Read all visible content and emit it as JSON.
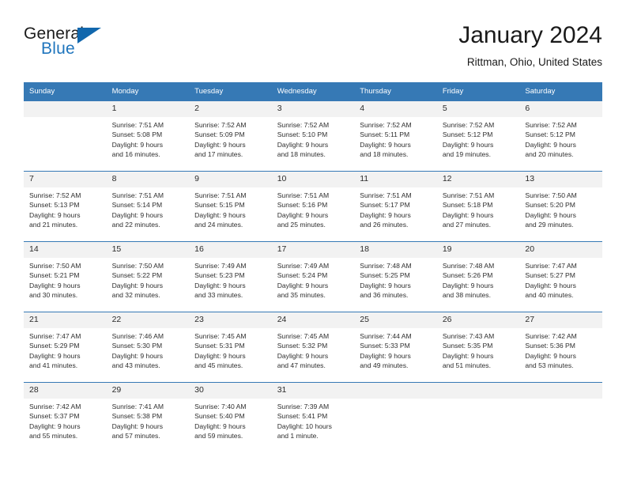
{
  "brand": {
    "name_part1": "General",
    "name_part2": "Blue",
    "triangle_icon": "triangle-icon",
    "colors": {
      "general": "#1c1c1c",
      "blue": "#1f75bd",
      "triangle": "#1167ad"
    }
  },
  "header": {
    "title": "January 2024",
    "subtitle": "Rittman, Ohio, United States"
  },
  "colors": {
    "header_row_background": "#3679b5",
    "header_row_text": "#ffffff",
    "daynum_background": "#f2f2f2",
    "cell_border": "#3679b5",
    "page_background": "#ffffff"
  },
  "weekday_headers": [
    "Sunday",
    "Monday",
    "Tuesday",
    "Wednesday",
    "Thursday",
    "Friday",
    "Saturday"
  ],
  "labels": {
    "sunrise_prefix": "Sunrise:",
    "sunset_prefix": "Sunset:",
    "daylight_prefix": "Daylight:"
  },
  "weeks": [
    [
      {
        "day": "",
        "sunrise": "",
        "sunset": "",
        "daylight_line1": "",
        "daylight_line2": "",
        "empty": true
      },
      {
        "day": "1",
        "sunrise": "Sunrise: 7:51 AM",
        "sunset": "Sunset: 5:08 PM",
        "daylight_line1": "Daylight: 9 hours",
        "daylight_line2": "and 16 minutes."
      },
      {
        "day": "2",
        "sunrise": "Sunrise: 7:52 AM",
        "sunset": "Sunset: 5:09 PM",
        "daylight_line1": "Daylight: 9 hours",
        "daylight_line2": "and 17 minutes."
      },
      {
        "day": "3",
        "sunrise": "Sunrise: 7:52 AM",
        "sunset": "Sunset: 5:10 PM",
        "daylight_line1": "Daylight: 9 hours",
        "daylight_line2": "and 18 minutes."
      },
      {
        "day": "4",
        "sunrise": "Sunrise: 7:52 AM",
        "sunset": "Sunset: 5:11 PM",
        "daylight_line1": "Daylight: 9 hours",
        "daylight_line2": "and 18 minutes."
      },
      {
        "day": "5",
        "sunrise": "Sunrise: 7:52 AM",
        "sunset": "Sunset: 5:12 PM",
        "daylight_line1": "Daylight: 9 hours",
        "daylight_line2": "and 19 minutes."
      },
      {
        "day": "6",
        "sunrise": "Sunrise: 7:52 AM",
        "sunset": "Sunset: 5:12 PM",
        "daylight_line1": "Daylight: 9 hours",
        "daylight_line2": "and 20 minutes."
      }
    ],
    [
      {
        "day": "7",
        "sunrise": "Sunrise: 7:52 AM",
        "sunset": "Sunset: 5:13 PM",
        "daylight_line1": "Daylight: 9 hours",
        "daylight_line2": "and 21 minutes."
      },
      {
        "day": "8",
        "sunrise": "Sunrise: 7:51 AM",
        "sunset": "Sunset: 5:14 PM",
        "daylight_line1": "Daylight: 9 hours",
        "daylight_line2": "and 22 minutes."
      },
      {
        "day": "9",
        "sunrise": "Sunrise: 7:51 AM",
        "sunset": "Sunset: 5:15 PM",
        "daylight_line1": "Daylight: 9 hours",
        "daylight_line2": "and 24 minutes."
      },
      {
        "day": "10",
        "sunrise": "Sunrise: 7:51 AM",
        "sunset": "Sunset: 5:16 PM",
        "daylight_line1": "Daylight: 9 hours",
        "daylight_line2": "and 25 minutes."
      },
      {
        "day": "11",
        "sunrise": "Sunrise: 7:51 AM",
        "sunset": "Sunset: 5:17 PM",
        "daylight_line1": "Daylight: 9 hours",
        "daylight_line2": "and 26 minutes."
      },
      {
        "day": "12",
        "sunrise": "Sunrise: 7:51 AM",
        "sunset": "Sunset: 5:18 PM",
        "daylight_line1": "Daylight: 9 hours",
        "daylight_line2": "and 27 minutes."
      },
      {
        "day": "13",
        "sunrise": "Sunrise: 7:50 AM",
        "sunset": "Sunset: 5:20 PM",
        "daylight_line1": "Daylight: 9 hours",
        "daylight_line2": "and 29 minutes."
      }
    ],
    [
      {
        "day": "14",
        "sunrise": "Sunrise: 7:50 AM",
        "sunset": "Sunset: 5:21 PM",
        "daylight_line1": "Daylight: 9 hours",
        "daylight_line2": "and 30 minutes."
      },
      {
        "day": "15",
        "sunrise": "Sunrise: 7:50 AM",
        "sunset": "Sunset: 5:22 PM",
        "daylight_line1": "Daylight: 9 hours",
        "daylight_line2": "and 32 minutes."
      },
      {
        "day": "16",
        "sunrise": "Sunrise: 7:49 AM",
        "sunset": "Sunset: 5:23 PM",
        "daylight_line1": "Daylight: 9 hours",
        "daylight_line2": "and 33 minutes."
      },
      {
        "day": "17",
        "sunrise": "Sunrise: 7:49 AM",
        "sunset": "Sunset: 5:24 PM",
        "daylight_line1": "Daylight: 9 hours",
        "daylight_line2": "and 35 minutes."
      },
      {
        "day": "18",
        "sunrise": "Sunrise: 7:48 AM",
        "sunset": "Sunset: 5:25 PM",
        "daylight_line1": "Daylight: 9 hours",
        "daylight_line2": "and 36 minutes."
      },
      {
        "day": "19",
        "sunrise": "Sunrise: 7:48 AM",
        "sunset": "Sunset: 5:26 PM",
        "daylight_line1": "Daylight: 9 hours",
        "daylight_line2": "and 38 minutes."
      },
      {
        "day": "20",
        "sunrise": "Sunrise: 7:47 AM",
        "sunset": "Sunset: 5:27 PM",
        "daylight_line1": "Daylight: 9 hours",
        "daylight_line2": "and 40 minutes."
      }
    ],
    [
      {
        "day": "21",
        "sunrise": "Sunrise: 7:47 AM",
        "sunset": "Sunset: 5:29 PM",
        "daylight_line1": "Daylight: 9 hours",
        "daylight_line2": "and 41 minutes."
      },
      {
        "day": "22",
        "sunrise": "Sunrise: 7:46 AM",
        "sunset": "Sunset: 5:30 PM",
        "daylight_line1": "Daylight: 9 hours",
        "daylight_line2": "and 43 minutes."
      },
      {
        "day": "23",
        "sunrise": "Sunrise: 7:45 AM",
        "sunset": "Sunset: 5:31 PM",
        "daylight_line1": "Daylight: 9 hours",
        "daylight_line2": "and 45 minutes."
      },
      {
        "day": "24",
        "sunrise": "Sunrise: 7:45 AM",
        "sunset": "Sunset: 5:32 PM",
        "daylight_line1": "Daylight: 9 hours",
        "daylight_line2": "and 47 minutes."
      },
      {
        "day": "25",
        "sunrise": "Sunrise: 7:44 AM",
        "sunset": "Sunset: 5:33 PM",
        "daylight_line1": "Daylight: 9 hours",
        "daylight_line2": "and 49 minutes."
      },
      {
        "day": "26",
        "sunrise": "Sunrise: 7:43 AM",
        "sunset": "Sunset: 5:35 PM",
        "daylight_line1": "Daylight: 9 hours",
        "daylight_line2": "and 51 minutes."
      },
      {
        "day": "27",
        "sunrise": "Sunrise: 7:42 AM",
        "sunset": "Sunset: 5:36 PM",
        "daylight_line1": "Daylight: 9 hours",
        "daylight_line2": "and 53 minutes."
      }
    ],
    [
      {
        "day": "28",
        "sunrise": "Sunrise: 7:42 AM",
        "sunset": "Sunset: 5:37 PM",
        "daylight_line1": "Daylight: 9 hours",
        "daylight_line2": "and 55 minutes."
      },
      {
        "day": "29",
        "sunrise": "Sunrise: 7:41 AM",
        "sunset": "Sunset: 5:38 PM",
        "daylight_line1": "Daylight: 9 hours",
        "daylight_line2": "and 57 minutes."
      },
      {
        "day": "30",
        "sunrise": "Sunrise: 7:40 AM",
        "sunset": "Sunset: 5:40 PM",
        "daylight_line1": "Daylight: 9 hours",
        "daylight_line2": "and 59 minutes."
      },
      {
        "day": "31",
        "sunrise": "Sunrise: 7:39 AM",
        "sunset": "Sunset: 5:41 PM",
        "daylight_line1": "Daylight: 10 hours",
        "daylight_line2": "and 1 minute."
      },
      {
        "day": "",
        "sunrise": "",
        "sunset": "",
        "daylight_line1": "",
        "daylight_line2": "",
        "empty": true
      },
      {
        "day": "",
        "sunrise": "",
        "sunset": "",
        "daylight_line1": "",
        "daylight_line2": "",
        "empty": true
      },
      {
        "day": "",
        "sunrise": "",
        "sunset": "",
        "daylight_line1": "",
        "daylight_line2": "",
        "empty": true
      }
    ]
  ]
}
